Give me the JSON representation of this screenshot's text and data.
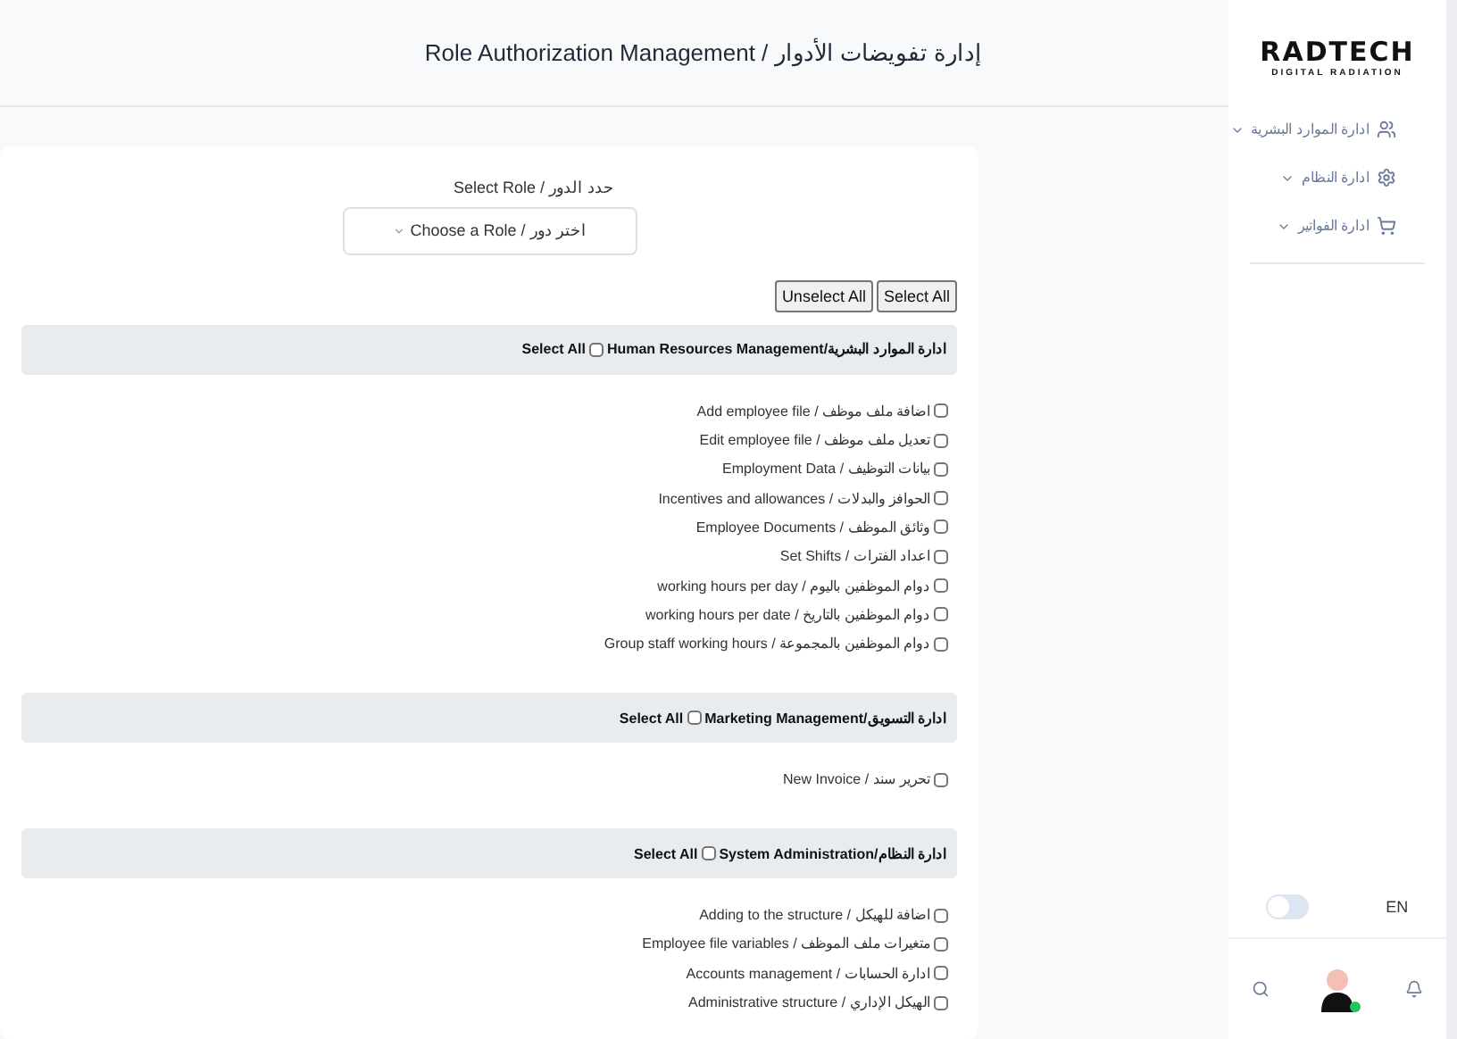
{
  "page_title": "Role Authorization Management / إدارة تفويضات الأدوار",
  "role_label": "Select Role / حدد الدور",
  "role_select": {
    "placeholder": "Choose a Role / اختر دور"
  },
  "buttons": [
    {
      "label": "Select All"
    },
    {
      "label": "Unselect All"
    }
  ],
  "sections": [
    {
      "title": "Human Resources Management/ادارة الموارد البشرية",
      "select_all": "Select All",
      "checked": false,
      "items": [
        {
          "label": "Add employee file / اضافة ملف موظف",
          "checked": false
        },
        {
          "label": "Edit employee file / تعديل ملف موظف",
          "checked": false
        },
        {
          "label": "Employment Data / بيانات التوظيف",
          "checked": false
        },
        {
          "label": "Incentives and allowances / الحوافز والبدلات",
          "checked": false
        },
        {
          "label": "Employee Documents / وثائق الموظف",
          "checked": false
        },
        {
          "label": "Set Shifts / اعداد الفترات",
          "checked": false
        },
        {
          "label": "working hours per day / دوام الموظفين باليوم",
          "checked": false
        },
        {
          "label": "working hours per date / دوام الموظفين بالتاريخ",
          "checked": false
        },
        {
          "label": "Group staff working hours / دوام الموظفين بالمجموعة",
          "checked": false
        }
      ]
    },
    {
      "title": "Marketing Management/ادارة التسويق",
      "select_all": "Select All",
      "checked": false,
      "items": [
        {
          "label": "New Invoice / تحرير سند",
          "checked": false
        }
      ]
    },
    {
      "title": "System Administration/ادارة النظام",
      "select_all": "Select All",
      "checked": false,
      "items": [
        {
          "label": "Adding to the structure / اضافة للهيكل",
          "checked": false
        },
        {
          "label": "Employee file variables / متغيرات ملف الموظف",
          "checked": false
        },
        {
          "label": "Accounts management / ادارة الحسابات",
          "checked": false
        },
        {
          "label": "Administrative structure / الهيكل الإداري",
          "checked": false
        }
      ]
    }
  ],
  "sidebar": {
    "logo": {
      "name": "RADTECH",
      "tagline": "DIGITAL RADIATION"
    },
    "nav": [
      {
        "label": "ادارة الموارد البشرية",
        "kind": "users"
      },
      {
        "label": "ادارة النظام",
        "kind": "settings"
      },
      {
        "label": "ادارة الفواتير",
        "kind": "cart"
      }
    ],
    "theme_toggle": {
      "on": false
    },
    "language": "EN"
  }
}
